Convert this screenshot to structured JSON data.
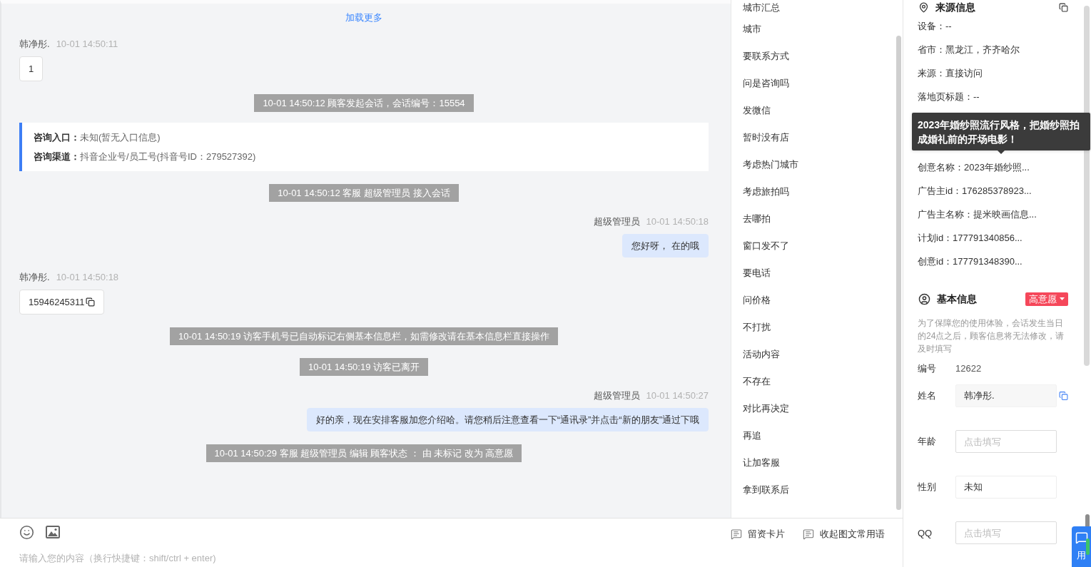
{
  "chat": {
    "load_more": "加载更多",
    "messages": [
      {
        "kind": "incoming",
        "sender": "韩净彤.",
        "time": "10-01 14:50:11",
        "text": "1",
        "copyable": false
      },
      {
        "kind": "notice",
        "text": "10-01 14:50:12 顾客发起会话，会话编号：15554"
      },
      {
        "kind": "entry_card",
        "lines": [
          {
            "label": "咨询入口：",
            "value": "未知(暂无入口信息)"
          },
          {
            "label": "咨询渠道：",
            "value": "抖音企业号/员工号(抖音号ID：279527392)"
          }
        ]
      },
      {
        "kind": "notice",
        "text": "10-01 14:50:12 客服 超级管理员 接入会话"
      },
      {
        "kind": "outgoing",
        "sender": "超级管理员",
        "time": "10-01 14:50:18",
        "text": "您好呀， 在的哦"
      },
      {
        "kind": "incoming",
        "sender": "韩净彤.",
        "time": "10-01 14:50:18",
        "text": "15946245311",
        "copyable": true
      },
      {
        "kind": "notice",
        "text": "10-01 14:50:19 访客手机号已自动标记右侧基本信息栏，如需修改请在基本信息栏直接操作"
      },
      {
        "kind": "notice",
        "text": "10-01 14:50:19 访客已离开"
      },
      {
        "kind": "outgoing",
        "sender": "超级管理员",
        "time": "10-01 14:50:27",
        "text": "好的亲，现在安排客服加您介绍哈。请您稍后注意查看一下“通讯录”并点击“新的朋友”通过下哦"
      },
      {
        "kind": "notice",
        "text": "10-01 14:50:29 客服 超级管理员 编辑 顾客状态 ： 由 未标记 改为 高意愿"
      }
    ]
  },
  "quick_replies": [
    "城市汇总",
    "城市",
    "要联系方式",
    "问是咨询吗",
    "发微信",
    "暂时没有店",
    "考虑热门城市",
    "考虑旅拍吗",
    "去哪拍",
    "窗口发不了",
    "要电话",
    "问价格",
    "不打扰",
    "活动内容",
    "不存在",
    "对比再决定",
    "再追",
    "让加客服",
    "拿到联系后"
  ],
  "composer": {
    "actions": [
      "留资卡片",
      "收起图文常用语"
    ],
    "placeholder": "请输入您的内容（换行快捷键：shift/ctrl + enter)"
  },
  "source_info": {
    "title": "来源信息",
    "rows": [
      {
        "text": "设备：--"
      },
      {
        "text": "省市：黑龙江，齐齐哈尔"
      },
      {
        "text": "来源：直接访问"
      },
      {
        "text": "落地页标题：--"
      },
      {
        "text": "创意名称：2023年婚纱照...",
        "tooltip": "2023年婚纱照流行风格，把婚纱照拍成婚礼前的开场电影！"
      },
      {
        "text": "广告主id：176285378923..."
      },
      {
        "text": "广告主名称：提米映画信息..."
      },
      {
        "text": "计划id：177791340856..."
      },
      {
        "text": "创意id：177791348390..."
      }
    ]
  },
  "basic_info": {
    "title": "基本信息",
    "status": "高意愿",
    "notice": "为了保障您的使用体验，会话发生当日的24点之后，顾客信息将无法修改，请及时填写",
    "fields": [
      {
        "kind": "text",
        "label": "编号",
        "value": "12622"
      },
      {
        "kind": "readonly",
        "label": "姓名",
        "value": "韩净彤.",
        "copyable": true
      },
      {
        "kind": "input",
        "label": "年龄",
        "placeholder": "点击填写"
      },
      {
        "kind": "select",
        "label": "性别",
        "value": "未知"
      },
      {
        "kind": "input",
        "label": "QQ",
        "placeholder": "点击填写"
      }
    ]
  },
  "side_tab": {
    "label": "用"
  }
}
